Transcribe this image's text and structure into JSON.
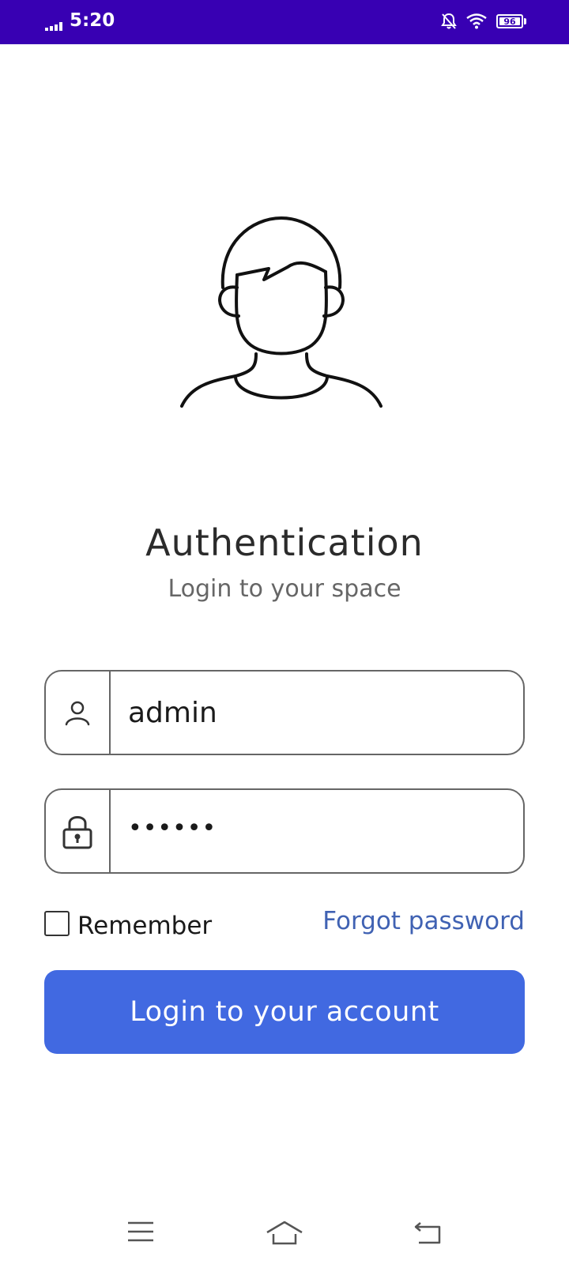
{
  "status_bar": {
    "time": "5:20",
    "battery_level": "96",
    "background_color": "#3800b3",
    "icons": [
      "signal-icon",
      "notifications-off-icon",
      "wifi-icon",
      "battery-icon"
    ]
  },
  "header": {
    "avatar_icon": "user-avatar-icon",
    "title": "Authentication",
    "subtitle": "Login to your space"
  },
  "form": {
    "username": {
      "value": "admin",
      "icon": "user-icon"
    },
    "password": {
      "value": "••••••",
      "icon": "lock-icon"
    },
    "remember_label": "Remember",
    "remember_checked": false,
    "forgot_label": "Forgot password",
    "submit_label": "Login to your account",
    "accent_color": "#4169e1",
    "link_color": "#4062b3"
  },
  "nav_bar": {
    "icons": [
      "menu-icon",
      "home-icon",
      "back-icon"
    ]
  }
}
